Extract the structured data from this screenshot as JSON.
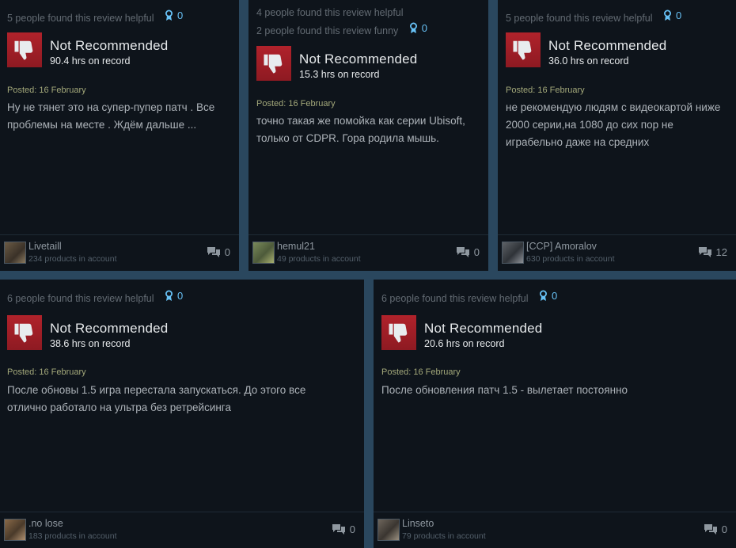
{
  "reviews": [
    {
      "helpful": "5 people found this review helpful",
      "funny": "",
      "awards": "0",
      "verdict": "Not Recommended",
      "hours": "90.4 hrs on record",
      "posted": "Posted: 16 February",
      "text": "Ну не тянет это на супер-пупер патч . Все проблемы на месте . Ждём дальше ...",
      "author": "Livetaill",
      "products": "234 products in account",
      "comments": "0"
    },
    {
      "helpful": "4 people found this review helpful",
      "funny": "2 people found this review funny",
      "awards": "0",
      "verdict": "Not Recommended",
      "hours": "15.3 hrs on record",
      "posted": "Posted: 16 February",
      "text": "точно такая же помойка как серии Ubisoft, только от CDPR. Гора родила мышь.",
      "author": "hemul21",
      "products": "49 products in account",
      "comments": "0"
    },
    {
      "helpful": "5 people found this review helpful",
      "funny": "",
      "awards": "0",
      "verdict": "Not Recommended",
      "hours": "36.0 hrs on record",
      "posted": "Posted: 16 February",
      "text": "не рекомендую людям с видеокартой ниже 2000 серии,на 1080 до сих пор не играбельно даже на средних",
      "author": "[CCP] Amoralov",
      "products": "630 products in account",
      "comments": "12"
    },
    {
      "helpful": "6 people found this review helpful",
      "funny": "",
      "awards": "0",
      "verdict": "Not Recommended",
      "hours": "38.6 hrs on record",
      "posted": "Posted: 16 February",
      "text": "После обновы 1.5 игра перестала запускаться. До этого все отлично работало на ультра без ретрейсинга",
      "author": ".no lose",
      "products": "183 products in account",
      "comments": "0"
    },
    {
      "helpful": "6 people found this review helpful",
      "funny": "",
      "awards": "0",
      "verdict": "Not Recommended",
      "hours": "20.6 hrs on record",
      "posted": "Posted: 16 February",
      "text": "После обновления патч 1.5 - вылетает постоянно",
      "author": "Linseto",
      "products": "79 products in account",
      "comments": "0"
    }
  ],
  "colors": {
    "background": "#2a475e",
    "card": "#0e141b",
    "thumb_red": "#a01f27",
    "award_blue": "#67c1f5",
    "posted": "#a3a87a"
  },
  "icons": {
    "thumb": "thumbs-down-icon",
    "award": "award-ribbon-icon",
    "comment": "comment-bubbles-icon"
  }
}
